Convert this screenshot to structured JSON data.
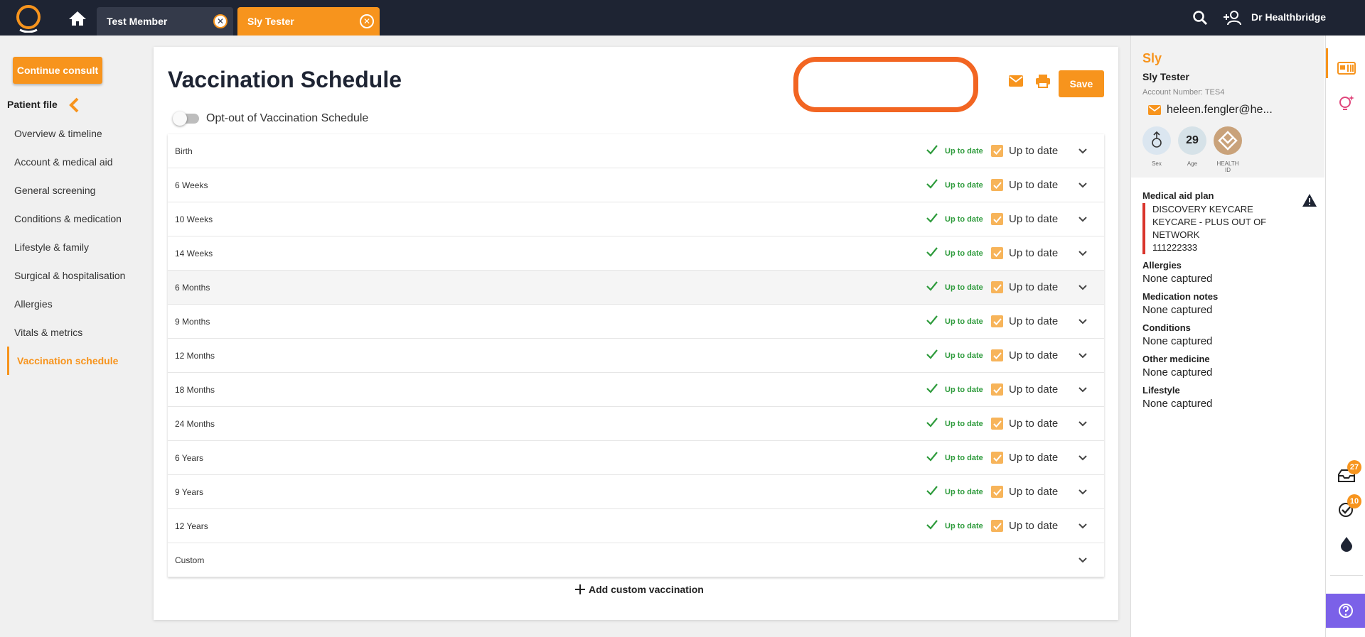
{
  "topbar": {
    "tabs": [
      {
        "label": "Test Member"
      },
      {
        "label": "Sly Tester"
      }
    ],
    "user_name": "Dr Healthbridge"
  },
  "sidebar": {
    "continue_label": "Continue consult",
    "section_title": "Patient file",
    "items": [
      {
        "label": "Overview & timeline"
      },
      {
        "label": "Account & medical aid"
      },
      {
        "label": "General screening"
      },
      {
        "label": "Conditions & medication"
      },
      {
        "label": "Lifestyle & family"
      },
      {
        "label": "Surgical & hospitalisation"
      },
      {
        "label": "Allergies"
      },
      {
        "label": "Vitals & metrics"
      },
      {
        "label": "Vaccination schedule"
      }
    ]
  },
  "main": {
    "title": "Vaccination Schedule",
    "save_label": "Save",
    "optout_label": "Opt-out of Vaccination Schedule",
    "rows": [
      {
        "label": "Birth",
        "status": "Up to date",
        "checkbox_label": "Up to date"
      },
      {
        "label": "6 Weeks",
        "status": "Up to date",
        "checkbox_label": "Up to date"
      },
      {
        "label": "10 Weeks",
        "status": "Up to date",
        "checkbox_label": "Up to date"
      },
      {
        "label": "14 Weeks",
        "status": "Up to date",
        "checkbox_label": "Up to date"
      },
      {
        "label": "6 Months",
        "status": "Up to date",
        "checkbox_label": "Up to date"
      },
      {
        "label": "9 Months",
        "status": "Up to date",
        "checkbox_label": "Up to date"
      },
      {
        "label": "12 Months",
        "status": "Up to date",
        "checkbox_label": "Up to date"
      },
      {
        "label": "18 Months",
        "status": "Up to date",
        "checkbox_label": "Up to date"
      },
      {
        "label": "24 Months",
        "status": "Up to date",
        "checkbox_label": "Up to date"
      },
      {
        "label": "6 Years",
        "status": "Up to date",
        "checkbox_label": "Up to date"
      },
      {
        "label": "9 Years",
        "status": "Up to date",
        "checkbox_label": "Up to date"
      },
      {
        "label": "12 Years",
        "status": "Up to date",
        "checkbox_label": "Up to date"
      },
      {
        "label": "Custom"
      }
    ],
    "add_custom_label": "Add custom vaccination"
  },
  "patient": {
    "first_name": "Sly",
    "full_name": "Sly Tester",
    "account": "Account Number: TES4",
    "email": "heleen.fengler@he...",
    "age": "29",
    "badge_labels": {
      "sex": "Sex",
      "age": "Age",
      "health_id": "HEALTH ID"
    },
    "medical_aid_title": "Medical aid plan",
    "medical_aid_lines": [
      "DISCOVERY KEYCARE",
      "KEYCARE - PLUS OUT OF",
      "NETWORK",
      "111222333"
    ],
    "sections": [
      {
        "title": "Allergies",
        "value": "None captured"
      },
      {
        "title": "Medication notes",
        "value": "None captured"
      },
      {
        "title": "Conditions",
        "value": "None captured"
      },
      {
        "title": "Other medicine",
        "value": "None captured"
      },
      {
        "title": "Lifestyle",
        "value": "None captured"
      }
    ]
  },
  "rail": {
    "counts": [
      "27",
      "10"
    ]
  },
  "colors": {
    "accent": "#f7941d",
    "topbar": "#1e2433",
    "success": "#2e9b3c",
    "highlight_ring": "#f26522",
    "help": "#7b61e8"
  }
}
